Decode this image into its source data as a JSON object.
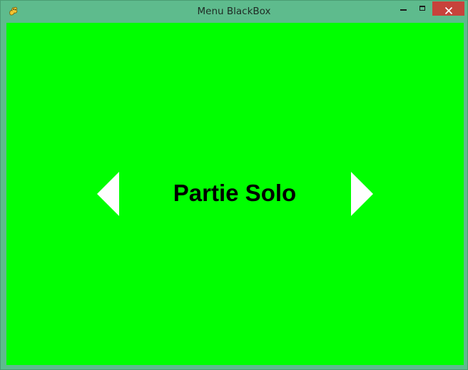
{
  "window": {
    "title": "Menu BlackBox",
    "app_icon": "pygame-snake-icon",
    "controls": {
      "minimize_icon": "minimize-icon",
      "maximize_icon": "maximize-icon",
      "close_icon": "close-icon"
    }
  },
  "menu": {
    "current_option": "Partie Solo",
    "prev_icon": "arrow-left-icon",
    "next_icon": "arrow-right-icon",
    "background_color": "#00ff00",
    "arrow_color": "#ffffff",
    "label_color": "#000000"
  }
}
